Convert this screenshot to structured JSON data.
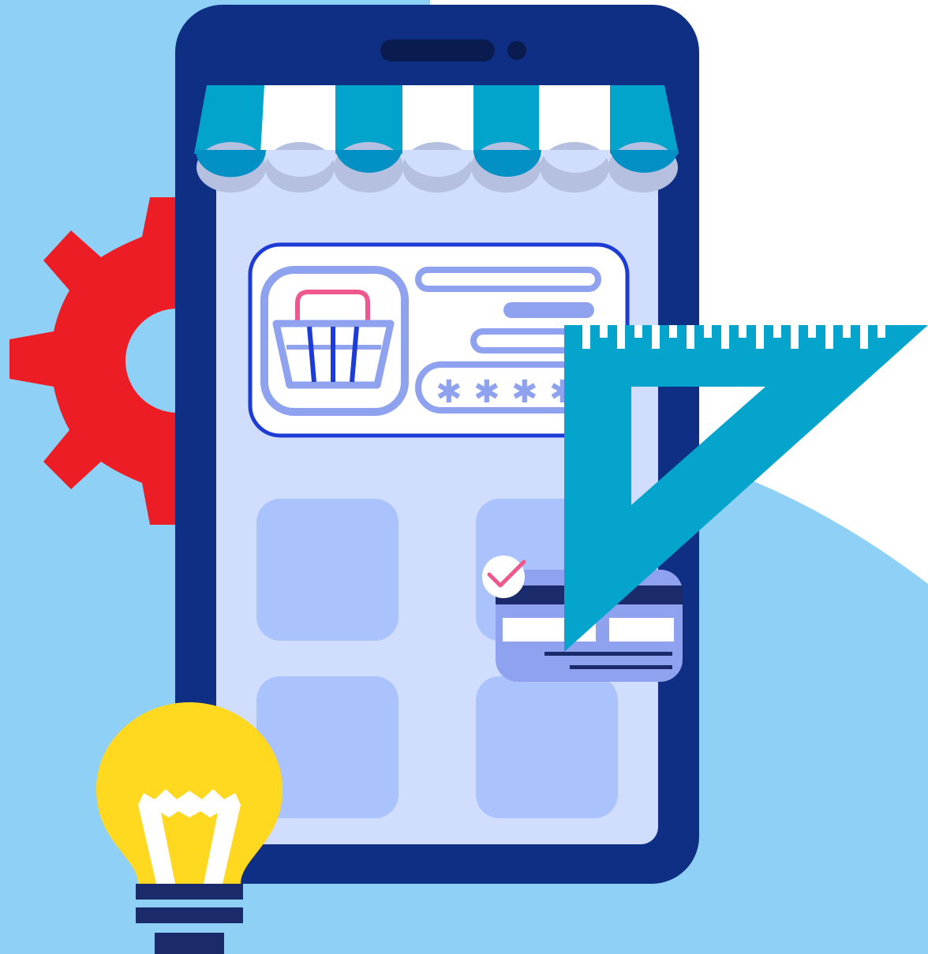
{
  "illustration": {
    "subject": "mobile-shop-app",
    "colors": {
      "sky": "#8fd0f7",
      "background": "#ffffff",
      "phone_body": "#0e2f83",
      "screen": "#d1ddfd",
      "tile": "#abc3fd",
      "awning_teal": "#03a4cc",
      "awning_white": "#ffffff",
      "gear": "#ec1d24",
      "bulb": "#ffd81f",
      "bulb_base": "#1b2a6b",
      "ruler": "#04a4cc",
      "card_outline": "#1d3cd6",
      "basket_handle": "#f0588d",
      "check": "#f0588d"
    },
    "icons": [
      "gear-icon",
      "shopping-basket-icon",
      "password-field-icon",
      "check-icon",
      "credit-card-icon",
      "light-bulb-icon",
      "set-square-icon"
    ],
    "password_mask": "****"
  }
}
